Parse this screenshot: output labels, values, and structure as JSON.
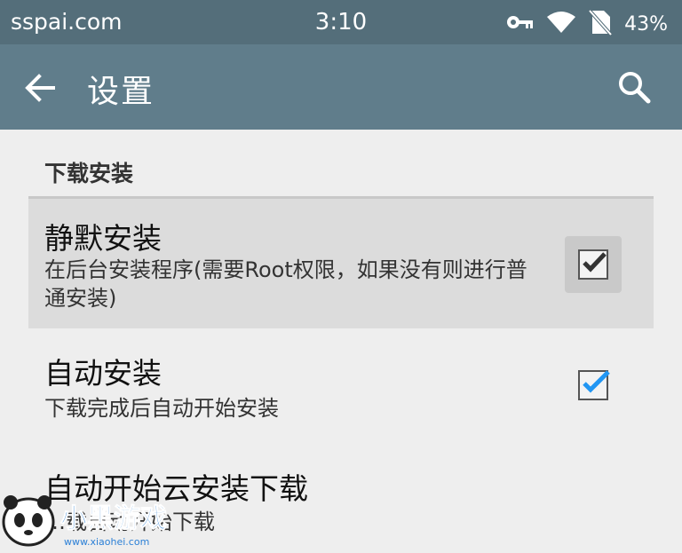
{
  "status_bar": {
    "carrier": "sspai.com",
    "time": "3:10",
    "battery": "43%",
    "icons": [
      "key-icon",
      "wifi-icon",
      "no-sim-icon"
    ]
  },
  "toolbar": {
    "title": "设置",
    "back_icon": "arrow-left-icon",
    "search_icon": "search-icon",
    "color": "#607d8b"
  },
  "section": {
    "header": "下载安装"
  },
  "preferences": [
    {
      "title": "静默安装",
      "summary": "在后台安装程序(需要Root权限，如果没有则进行普通安装)",
      "checked": true,
      "checkmark_color": "#333333"
    },
    {
      "title": "自动安装",
      "summary": "下载完成后自动开始安装",
      "checked": true,
      "checkmark_color": "#2196f3"
    },
    {
      "title": "自动开始云安装下载",
      "summary": "…载自动开始下载"
    }
  ],
  "watermark": {
    "text": "小黑游戏",
    "url": "www.xiaohei.com"
  }
}
